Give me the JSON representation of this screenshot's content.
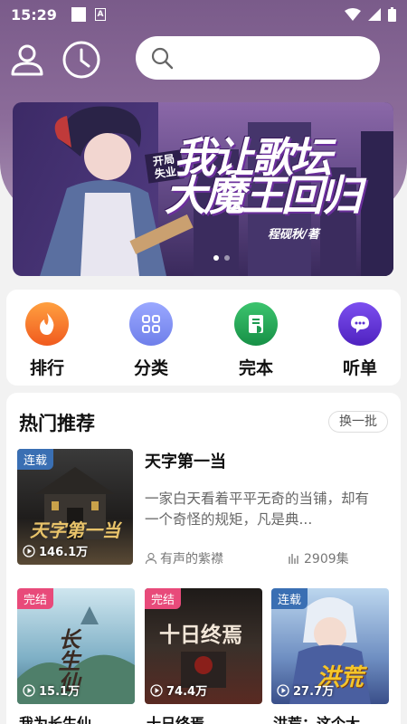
{
  "status": {
    "time": "15:29"
  },
  "header": {
    "search_placeholder": ""
  },
  "banner": {
    "tag": "开局失业",
    "title_line1": "我让歌坛",
    "title_line2": "大魔王回归",
    "author": "程砚秋/著"
  },
  "categories": [
    {
      "label": "排行",
      "icon": "flame-icon",
      "color": "#f7722a"
    },
    {
      "label": "分类",
      "icon": "grid-icon",
      "color": "#7d8cf2"
    },
    {
      "label": "完本",
      "icon": "book-icon",
      "color": "#22a35a"
    },
    {
      "label": "听单",
      "icon": "chat-icon",
      "color": "#6a3cd6"
    }
  ],
  "recommend": {
    "title": "热门推荐",
    "refresh_label": "换一批",
    "featured": {
      "title": "天字第一当",
      "badge": "连载",
      "plays": "146.1万",
      "description": "一家白天看着平平无奇的当铺，却有一个奇怪的规矩，凡是典...",
      "author": "有声的紫襟",
      "episodes": "2909集",
      "cover_text": "天字第一当"
    },
    "books": [
      {
        "badge": "完结",
        "plays": "15.1万",
        "title": "我为长生仙",
        "cover_text": "长生仙"
      },
      {
        "badge": "完结",
        "plays": "74.4万",
        "title": "十日终焉",
        "cover_text": "十日终焉"
      },
      {
        "badge": "连载",
        "plays": "27.7万",
        "title": "洪荒：这个大",
        "cover_text": "洪荒"
      }
    ]
  },
  "colors": {
    "header_bg": "#7a5b8a",
    "badge_serial": "#2e6cb8",
    "badge_done": "#e84a7a"
  }
}
